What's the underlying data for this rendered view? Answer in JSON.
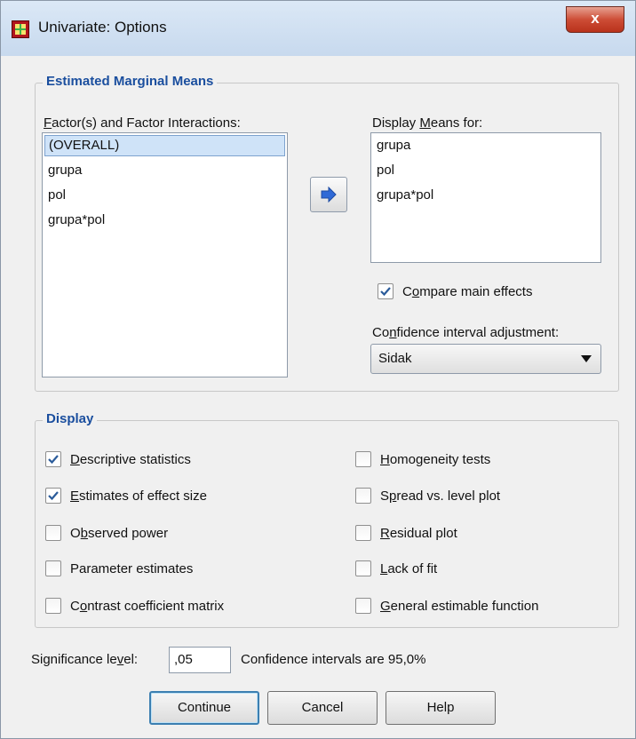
{
  "window": {
    "title": "Univariate: Options",
    "close_symbol": "x"
  },
  "emm": {
    "legend": "Estimated Marginal Means",
    "factors_label_pre": "",
    "factors_label_u": "F",
    "factors_label_post": "actor(s) and Factor Interactions:",
    "factors": [
      "(OVERALL)",
      "grupa",
      "pol",
      "grupa*pol"
    ],
    "selected_factor": "(OVERALL)",
    "display_label_pre": "Display ",
    "display_label_u": "M",
    "display_label_post": "eans for:",
    "display_means": [
      "grupa",
      "pol",
      "grupa*pol"
    ],
    "compare_pre": "C",
    "compare_u": "o",
    "compare_post": "mpare main effects",
    "compare_checked": true,
    "ci_label_pre": "Co",
    "ci_label_u": "n",
    "ci_label_post": "fidence interval adjustment:",
    "ci_value": "Sidak"
  },
  "display": {
    "legend": "Display",
    "left": [
      {
        "pre": "",
        "u": "D",
        "post": "escriptive statistics",
        "checked": true
      },
      {
        "pre": "",
        "u": "E",
        "post": "stimates of effect size",
        "checked": true
      },
      {
        "pre": "O",
        "u": "b",
        "post": "served power",
        "checked": false
      },
      {
        "pre": "Parameter estimates",
        "u": "",
        "post": "",
        "checked": false
      },
      {
        "pre": "C",
        "u": "o",
        "post": "ntrast coefficient matrix",
        "checked": false
      }
    ],
    "right": [
      {
        "pre": "",
        "u": "H",
        "post": "omogeneity tests",
        "checked": false
      },
      {
        "pre": "S",
        "u": "p",
        "post": "read vs. level plot",
        "checked": false
      },
      {
        "pre": "",
        "u": "R",
        "post": "esidual plot",
        "checked": false
      },
      {
        "pre": "",
        "u": "L",
        "post": "ack of fit",
        "checked": false
      },
      {
        "pre": "",
        "u": "G",
        "post": "eneral estimable function",
        "checked": false
      }
    ]
  },
  "significance": {
    "label_pre": "Significance le",
    "label_u": "v",
    "label_post": "el:",
    "value": ",05",
    "ci_text": "Confidence intervals are 95,0%"
  },
  "buttons": {
    "continue": "Continue",
    "cancel": "Cancel",
    "help": "Help"
  },
  "colors": {
    "legend_text": "#1a4e9e",
    "selection_bg": "#cfe3f8",
    "checkmark": "#2a5b9a",
    "arrow_icon": "#2f69d6",
    "close_button": "#cd4d36"
  }
}
